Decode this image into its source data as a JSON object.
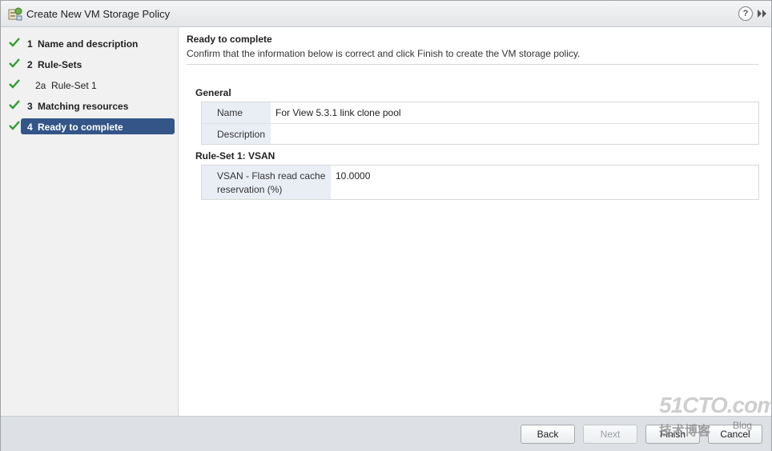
{
  "window": {
    "title": "Create New VM Storage Policy",
    "help_glyph": "?",
    "icons": {
      "title": "storage-policy-icon",
      "help": "help-icon",
      "expand": "expand-icon"
    }
  },
  "nav": {
    "items": [
      {
        "num": "1",
        "label": "Name and description",
        "checked": true,
        "active": false,
        "sub": false
      },
      {
        "num": "2",
        "label": "Rule-Sets",
        "checked": true,
        "active": false,
        "sub": false
      },
      {
        "num": "2a",
        "label": "Rule-Set 1",
        "checked": true,
        "active": false,
        "sub": true
      },
      {
        "num": "3",
        "label": "Matching resources",
        "checked": true,
        "active": false,
        "sub": false
      },
      {
        "num": "4",
        "label": "Ready to complete",
        "checked": true,
        "active": true,
        "sub": false
      }
    ]
  },
  "content": {
    "title": "Ready to complete",
    "description": "Confirm that the information below is correct and click Finish to create the VM storage policy.",
    "general": {
      "heading": "General",
      "rows": [
        {
          "label": "Name",
          "value": "For View 5.3.1 link clone pool"
        },
        {
          "label": "Description",
          "value": ""
        }
      ]
    },
    "ruleset": {
      "heading": "Rule-Set 1: VSAN",
      "rows": [
        {
          "label": "VSAN - Flash read cache reservation (%)",
          "value": "10.0000"
        }
      ]
    }
  },
  "footer": {
    "back": "Back",
    "next": "Next",
    "finish": "Finish",
    "cancel": "Cancel"
  },
  "watermark": {
    "logo": "51CTO.com",
    "sub": "技术博客",
    "blog": "Blog"
  },
  "colors": {
    "accent": "#335588",
    "check": "#2f9e2f",
    "label_bg": "#e9eef5",
    "footer_bg": "#dde1e6"
  }
}
